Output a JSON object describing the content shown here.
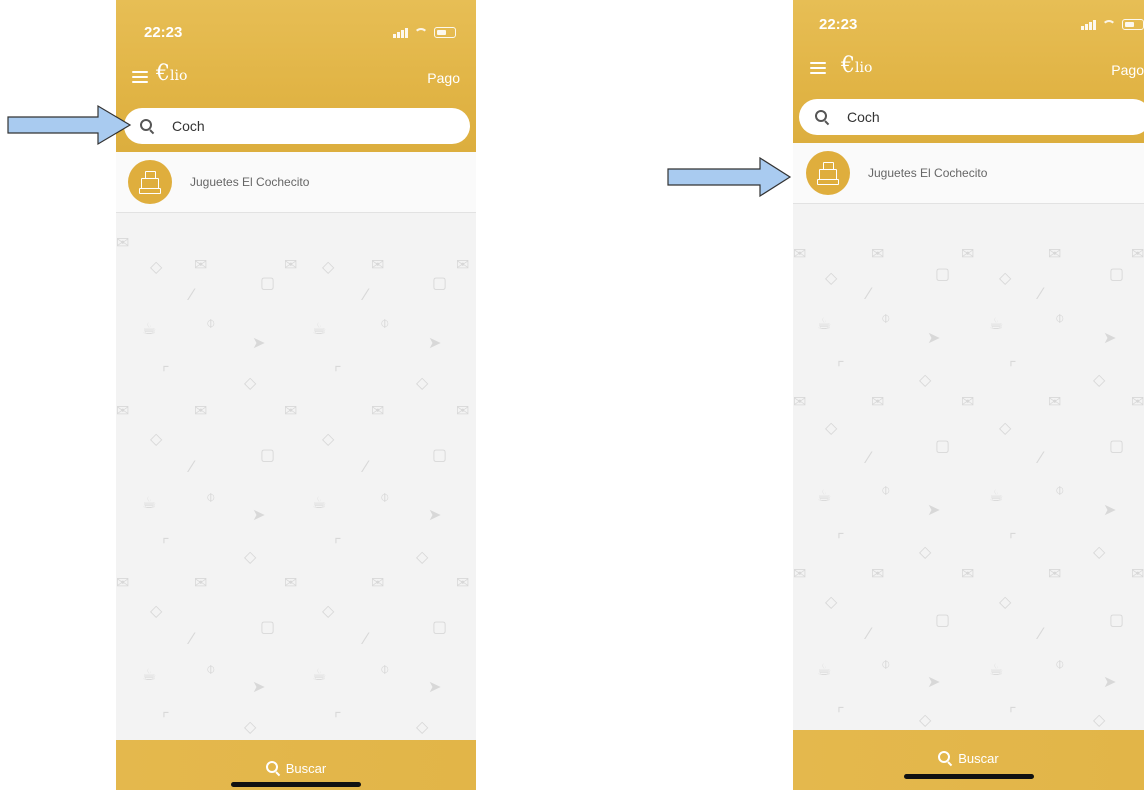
{
  "screens": [
    {
      "status": {
        "time": "22:23"
      },
      "header": {
        "logo_main": "€",
        "logo_sub": "lio",
        "pay_label": "Pago"
      },
      "search": {
        "value": "Coch",
        "placeholder": ""
      },
      "results": [
        {
          "name": "Juguetes El Cochecito",
          "icon": "cash-register-icon"
        }
      ],
      "bottom_bar": {
        "search_label": "Buscar"
      }
    },
    {
      "status": {
        "time": "22:23"
      },
      "header": {
        "logo_main": "€",
        "logo_sub": "lio",
        "pay_label": "Pago"
      },
      "search": {
        "value": "Coch",
        "placeholder": ""
      },
      "results": [
        {
          "name": "Juguetes El Cochecito",
          "icon": "cash-register-icon"
        }
      ],
      "bottom_bar": {
        "search_label": "Buscar"
      }
    }
  ],
  "annotations": [
    {
      "name": "arrow-to-search",
      "color": "#a9cbf0",
      "points_to": "search-input"
    },
    {
      "name": "arrow-to-result",
      "color": "#a9cbf0",
      "points_to": "result-item"
    }
  ],
  "colors": {
    "brand_gold": "#e1b445",
    "avatar_gold": "#dfae3d",
    "background": "#f3f3f3"
  }
}
